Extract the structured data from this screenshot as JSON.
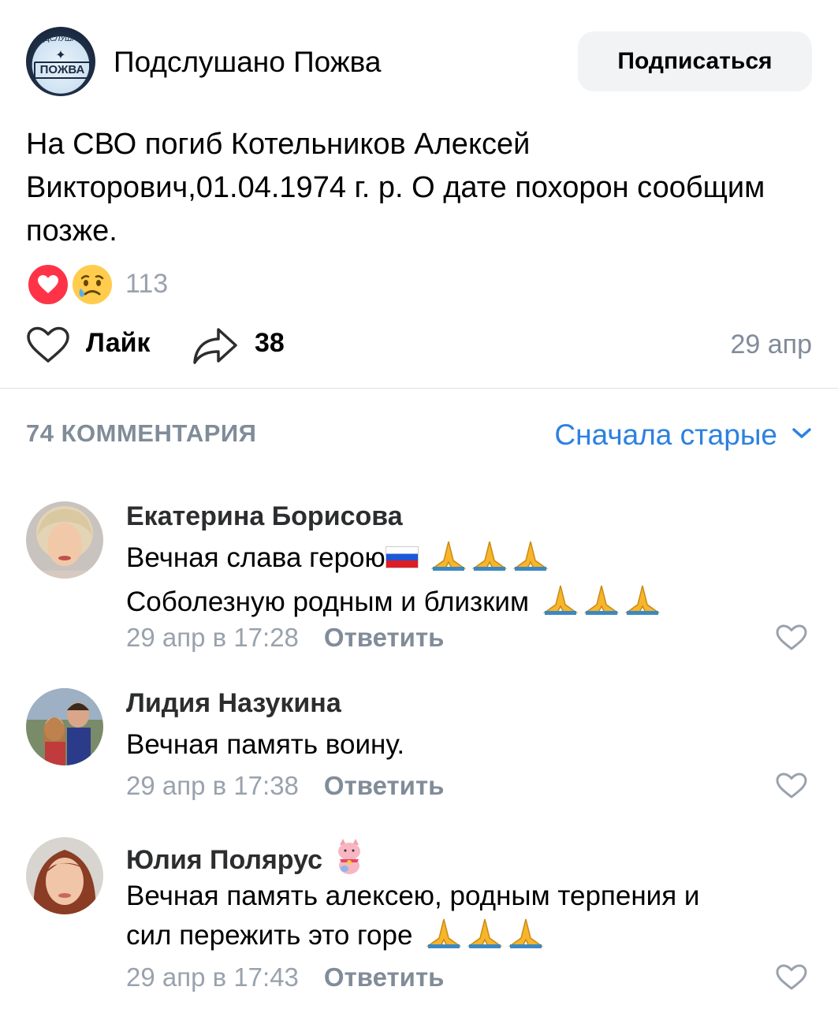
{
  "group": {
    "name": "Подслушано Пожва",
    "logo_top": "ПОДСЛУШАНО",
    "logo_main": "ПОЖВА",
    "subscribe_label": "Подписаться"
  },
  "post": {
    "text": "На СВО погиб Котельников Алексей Викторович,01.04.1974 г. р. О дате похорон сообщим позже.",
    "reactions": [
      "heart-icon",
      "crying-face-icon"
    ],
    "reactions_count": "113",
    "like_label": "Лайк",
    "share_count": "38",
    "date": "29 апр"
  },
  "comments_section": {
    "count_label": "74 КОММЕНТАРИЯ",
    "sort_label": "Сначала старые"
  },
  "comments": [
    {
      "author": "Екатерина Борисова",
      "line1": "Вечная слава герою",
      "line2": "Соболезную родным и близким",
      "time": "29 апр в 17:28",
      "reply": "Ответить"
    },
    {
      "author": "Лидия Назукина",
      "line1": "Вечная память воину.",
      "time": "29 апр в 17:38",
      "reply": "Ответить"
    },
    {
      "author": "Юлия Полярус",
      "line1": "Вечная память алексею, родным терпения и",
      "line2": "сил пережить это горе",
      "time": "29 апр в 17:43",
      "reply": "Ответить"
    }
  ],
  "colors": {
    "accent": "#2d81e0",
    "secondary_text": "#818c99",
    "reaction_heart": "#ff3347",
    "button_bg": "#f2f3f5"
  }
}
